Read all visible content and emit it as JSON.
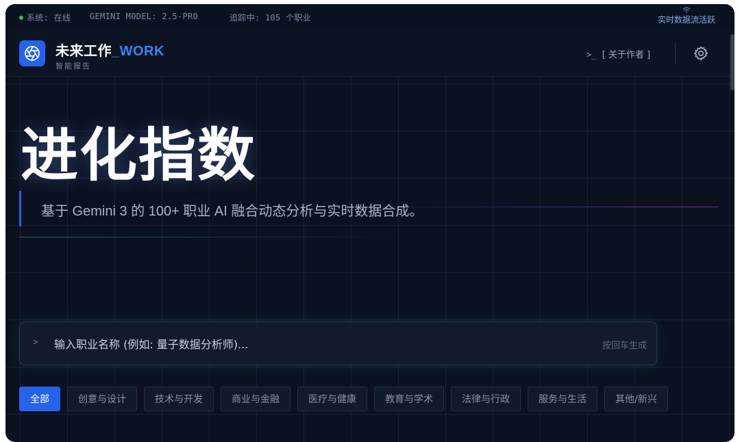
{
  "status": {
    "system": "系统: 在线",
    "model": "GEMINI MODEL: 2.5-PRO",
    "tracking": "追踪中: 105 个职业",
    "live": "实时数据流活跃"
  },
  "header": {
    "title_main": "未来工作",
    "title_accent": "_WORK",
    "subtitle": "智能报告",
    "about_prompt": ">_",
    "about_label": "[ 关于作者 ]"
  },
  "hero": {
    "title": "进化指数",
    "subtitle": "基于 Gemini 3 的 100+ 职业 AI 融合动态分析与实时数据合成。"
  },
  "search": {
    "caret": ">",
    "placeholder": "输入职业名称 (例如: 量子数据分析师)...",
    "hint": "按回车生成"
  },
  "categories": [
    {
      "label": "全部",
      "active": true
    },
    {
      "label": "创意与设计"
    },
    {
      "label": "技术与开发"
    },
    {
      "label": "商业与金融"
    },
    {
      "label": "医疗与健康"
    },
    {
      "label": "教育与学术"
    },
    {
      "label": "法律与行政"
    },
    {
      "label": "服务与生活"
    },
    {
      "label": "其他/新兴"
    }
  ],
  "colors": {
    "accent": "#2563eb",
    "background": "#0b1120",
    "status_online": "#22c55e"
  }
}
